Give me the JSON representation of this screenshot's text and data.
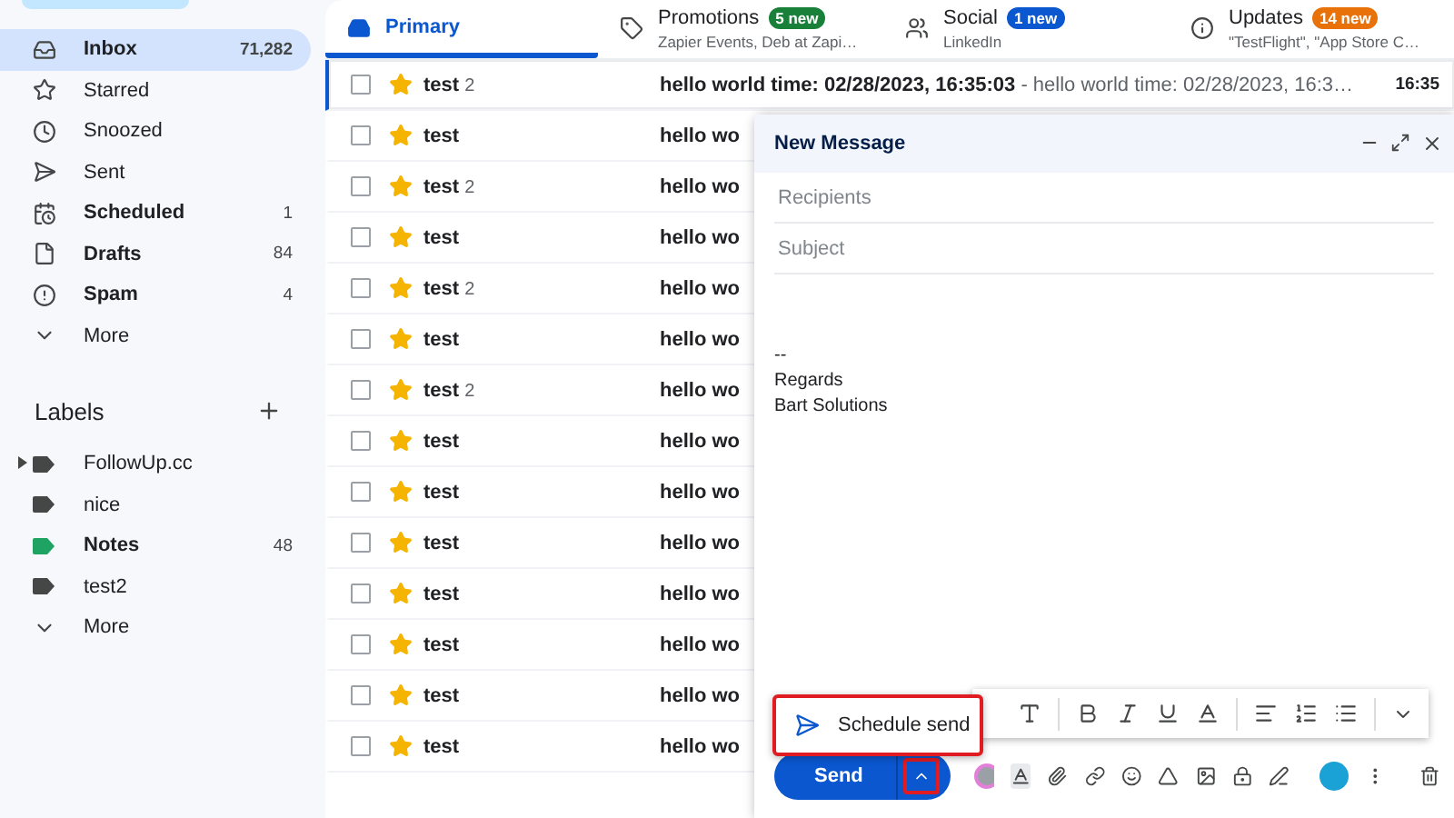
{
  "sidebar": {
    "nav": [
      {
        "label": "Inbox",
        "count": "71,282",
        "bold": true,
        "selected": true
      },
      {
        "label": "Starred",
        "bold": false,
        "selected": false
      },
      {
        "label": "Snoozed",
        "bold": false,
        "selected": false
      },
      {
        "label": "Sent",
        "bold": false,
        "selected": false
      },
      {
        "label": "Scheduled",
        "count": "1",
        "bold": true,
        "selected": false
      },
      {
        "label": "Drafts",
        "count": "84",
        "bold": true,
        "selected": false
      },
      {
        "label": "Spam",
        "count": "4",
        "bold": true,
        "selected": false
      },
      {
        "label": "More",
        "bold": false,
        "selected": false
      }
    ],
    "labels_title": "Labels",
    "labels": [
      {
        "label": "FollowUp.cc",
        "color": "#444746",
        "bold": false,
        "has_children": true
      },
      {
        "label": "nice",
        "color": "#444746",
        "bold": false,
        "has_children": false
      },
      {
        "label": "Notes",
        "count": "48",
        "color": "#1ea362",
        "bold": true,
        "has_children": false
      },
      {
        "label": "test2",
        "color": "#444746",
        "bold": false,
        "has_children": false
      }
    ],
    "labels_more": "More"
  },
  "tabs": [
    {
      "label": "Primary",
      "selected": true
    },
    {
      "label": "Promotions",
      "badge": "5 new",
      "color": "#188038",
      "snippet": "Zapier Events, Deb at Zapi…",
      "selected": false
    },
    {
      "label": "Social",
      "badge": "1 new",
      "color": "#0b57d0",
      "snippet": "LinkedIn",
      "selected": false
    },
    {
      "label": "Updates",
      "badge": "14 new",
      "color": "#e8710a",
      "snippet": "\"TestFlight\", \"App Store C…",
      "selected": false
    }
  ],
  "rows": [
    {
      "sender": "test",
      "count": "2",
      "subject": "hello world time: 02/28/2023, 16:35:03",
      "snippet": " - hello world time: 02/28/2023, 16:3…",
      "time": "16:35",
      "checked": false,
      "starred": true,
      "focused": true
    },
    {
      "sender": "test",
      "subject": "hello wo",
      "checked": false,
      "starred": true,
      "focused": false
    },
    {
      "sender": "test",
      "count": "2",
      "subject": "hello wo",
      "checked": false,
      "starred": true,
      "focused": false
    },
    {
      "sender": "test",
      "subject": "hello wo",
      "checked": false,
      "starred": true,
      "focused": false
    },
    {
      "sender": "test",
      "count": "2",
      "subject": "hello wo",
      "checked": false,
      "starred": true,
      "focused": false
    },
    {
      "sender": "test",
      "subject": "hello wo",
      "checked": false,
      "starred": true,
      "focused": false
    },
    {
      "sender": "test",
      "count": "2",
      "subject": "hello wo",
      "checked": false,
      "starred": true,
      "focused": false
    },
    {
      "sender": "test",
      "subject": "hello wo",
      "checked": false,
      "starred": true,
      "focused": false
    },
    {
      "sender": "test",
      "subject": "hello wo",
      "checked": false,
      "starred": true,
      "focused": false
    },
    {
      "sender": "test",
      "subject": "hello wo",
      "checked": false,
      "starred": true,
      "focused": false
    },
    {
      "sender": "test",
      "subject": "hello wo",
      "checked": false,
      "starred": true,
      "focused": false
    },
    {
      "sender": "test",
      "subject": "hello wo",
      "checked": false,
      "starred": true,
      "focused": false
    },
    {
      "sender": "test",
      "subject": "hello wo",
      "checked": false,
      "starred": true,
      "focused": false
    },
    {
      "sender": "test",
      "subject": "hello wo",
      "checked": false,
      "starred": true,
      "focused": false
    }
  ],
  "compose": {
    "title": "New Message",
    "recipients": {
      "placeholder": "Recipients"
    },
    "subject": {
      "placeholder": "Subject"
    },
    "body": [
      "--",
      "Regards",
      "Bart Solutions"
    ],
    "schedule_menu": {
      "label": "Schedule send",
      "highlighted": true
    },
    "send": "Send",
    "more_send_highlighted": true
  }
}
